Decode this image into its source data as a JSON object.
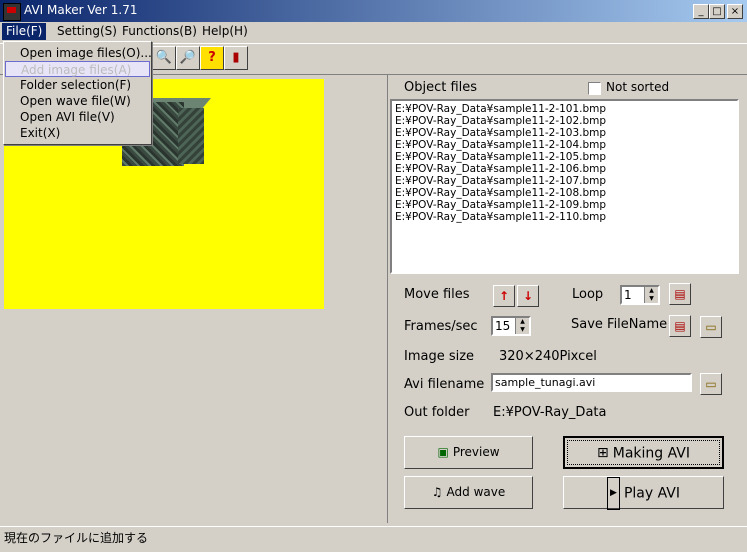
{
  "window": {
    "title": "AVI Maker Ver 1.71",
    "minimize_glyph": "_",
    "maximize_glyph": "□",
    "close_glyph": "×"
  },
  "menubar": {
    "file": "File(F)",
    "setting": "Setting(S)",
    "functions": "Functions(B)",
    "help": "Help(H)"
  },
  "file_menu": {
    "items": [
      {
        "label": "Open image files(O)..."
      },
      {
        "label": "Add image files(A)"
      },
      {
        "label": "Folder selection(F)"
      },
      {
        "label": "Open wave file(W)"
      },
      {
        "label": "Open AVI file(V)"
      },
      {
        "label": "Exit(X)"
      }
    ]
  },
  "toolbar": {
    "icons": [
      "image-search-icon",
      "find-icon",
      "help-icon",
      "exit-door-icon"
    ],
    "glyphs": [
      "🔍",
      "🔎",
      "?",
      "▮"
    ]
  },
  "object_files": {
    "heading": "Object files",
    "not_sorted_label": "Not sorted",
    "files": [
      "E:¥POV-Ray_Data¥sample11-2-101.bmp",
      "E:¥POV-Ray_Data¥sample11-2-102.bmp",
      "E:¥POV-Ray_Data¥sample11-2-103.bmp",
      "E:¥POV-Ray_Data¥sample11-2-104.bmp",
      "E:¥POV-Ray_Data¥sample11-2-105.bmp",
      "E:¥POV-Ray_Data¥sample11-2-106.bmp",
      "E:¥POV-Ray_Data¥sample11-2-107.bmp",
      "E:¥POV-Ray_Data¥sample11-2-108.bmp",
      "E:¥POV-Ray_Data¥sample11-2-109.bmp",
      "E:¥POV-Ray_Data¥sample11-2-110.bmp"
    ]
  },
  "controls": {
    "move_files_label": "Move files",
    "up_glyph": "↑",
    "down_glyph": "↓",
    "loop_label": "Loop",
    "loop_value": "1",
    "frames_label": "Frames/sec",
    "frames_value": "15",
    "save_filename_label": "Save FileName",
    "image_size_label": "Image size",
    "image_size_value": "320×240Pixcel",
    "avi_filename_label": "Avi filename",
    "avi_filename_value": "sample_tunagi.avi",
    "out_folder_label": "Out folder",
    "out_folder_value": "E:¥POV-Ray_Data"
  },
  "buttons": {
    "preview": "Preview",
    "making_avi": "Making AVI",
    "add_wave": "Add wave",
    "play_avi": "Play AVI"
  },
  "status": {
    "text": "現在のファイルに追加する"
  },
  "colors": {
    "preview_background": "#ffff00",
    "titlebar_start": "#0a246a",
    "titlebar_end": "#a6caf0",
    "arrow_red": "#cc0000"
  }
}
